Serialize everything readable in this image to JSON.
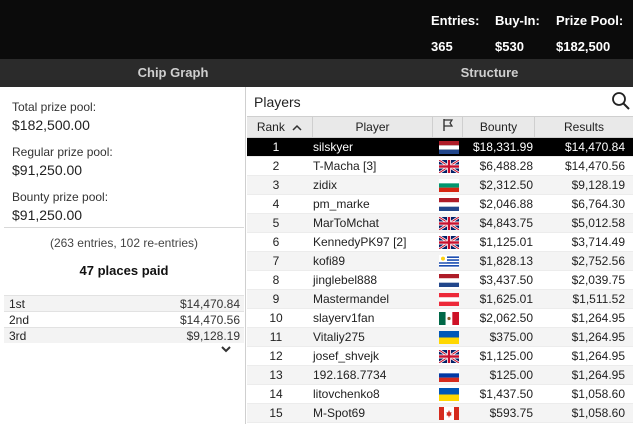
{
  "header": {
    "stats": [
      {
        "label": "Entries:",
        "value": "365"
      },
      {
        "label": "Buy-In:",
        "value": "$530"
      },
      {
        "label": "Prize Pool:",
        "value": "$182,500"
      }
    ],
    "tabs": [
      {
        "label": "Chip Graph"
      },
      {
        "label": "Structure"
      }
    ]
  },
  "summary": {
    "total_label": "Total prize pool:",
    "total_value": "$182,500.00",
    "regular_label": "Regular prize pool:",
    "regular_value": "$91,250.00",
    "bounty_label": "Bounty prize pool:",
    "bounty_value": "$91,250.00",
    "entries_note": "(263 entries, 102 re-entries)",
    "places_paid": "47 places paid",
    "payouts": [
      {
        "place": "1st",
        "amount": "$14,470.84"
      },
      {
        "place": "2nd",
        "amount": "$14,470.56"
      },
      {
        "place": "3rd",
        "amount": "$9,128.19"
      }
    ]
  },
  "players": {
    "title": "Players",
    "columns": {
      "rank": "Rank",
      "player": "Player",
      "bounty": "Bounty",
      "results": "Results"
    },
    "icons": {
      "search": "search-icon",
      "flag_column": "flag-icon",
      "sort": "sort-up-icon",
      "expand": "chevron-down-icon"
    },
    "rows": [
      {
        "rank": "1",
        "player": "silskyer",
        "flag": "netherlands",
        "bounty": "$18,331.99",
        "result": "$14,470.84"
      },
      {
        "rank": "2",
        "player": "T-Macha [3]",
        "flag": "uk",
        "bounty": "$6,488.28",
        "result": "$14,470.56"
      },
      {
        "rank": "3",
        "player": "zidix",
        "flag": "bulgaria",
        "bounty": "$2,312.50",
        "result": "$9,128.19"
      },
      {
        "rank": "4",
        "player": "pm_marke",
        "flag": "netherlands",
        "bounty": "$2,046.88",
        "result": "$6,764.30"
      },
      {
        "rank": "5",
        "player": "MarToMchat",
        "flag": "uk",
        "bounty": "$4,843.75",
        "result": "$5,012.58"
      },
      {
        "rank": "6",
        "player": "KennedyPK97 [2]",
        "flag": "uk",
        "bounty": "$1,125.01",
        "result": "$3,714.49"
      },
      {
        "rank": "7",
        "player": "kofi89",
        "flag": "uruguay",
        "bounty": "$1,828.13",
        "result": "$2,752.56"
      },
      {
        "rank": "8",
        "player": "jinglebel888",
        "flag": "netherlands",
        "bounty": "$3,437.50",
        "result": "$2,039.75"
      },
      {
        "rank": "9",
        "player": "Mastermandel",
        "flag": "austria",
        "bounty": "$1,625.01",
        "result": "$1,511.52"
      },
      {
        "rank": "10",
        "player": "slayerv1fan",
        "flag": "mexico",
        "bounty": "$2,062.50",
        "result": "$1,264.95"
      },
      {
        "rank": "11",
        "player": "Vitaliy275",
        "flag": "ukraine",
        "bounty": "$375.00",
        "result": "$1,264.95"
      },
      {
        "rank": "12",
        "player": "josef_shvejk",
        "flag": "uk",
        "bounty": "$1,125.00",
        "result": "$1,264.95"
      },
      {
        "rank": "13",
        "player": "192.168.7734",
        "flag": "russia",
        "bounty": "$125.00",
        "result": "$1,264.95"
      },
      {
        "rank": "14",
        "player": "litovchenko8",
        "flag": "ukraine",
        "bounty": "$1,437.50",
        "result": "$1,058.60"
      },
      {
        "rank": "15",
        "player": "M-Spot69",
        "flag": "canada",
        "bounty": "$593.75",
        "result": "$1,058.60"
      }
    ]
  }
}
